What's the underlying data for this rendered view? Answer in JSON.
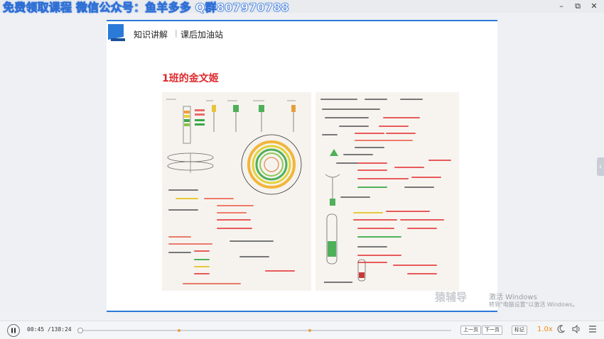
{
  "titlebar": {
    "watermark": "免费领取课程 微信公众号：鱼羊多多 Q群807970788",
    "minimize": "–",
    "maximize": "⧉",
    "close": "✕"
  },
  "slide": {
    "nav_primary": "知识讲解",
    "nav_separator": "|",
    "nav_secondary": "课后加油站",
    "heading": "1班的金文姬"
  },
  "overlay": {
    "brand": "猿辅导",
    "activate_title": "激活 Windows",
    "activate_hint": "转到\"电脑设置\"以激活 Windows。"
  },
  "player": {
    "time": "00:45 /138:24",
    "progress_fraction": 0.006,
    "chapter_marks": [
      0.27,
      0.62
    ],
    "prev_label": "上一页",
    "next_label": "下一页",
    "mark_label": "标记",
    "speed": "1.0x"
  },
  "side_handle": "‹",
  "colors": {
    "accent_blue": "#2a7ad8",
    "heading_red": "#e0282b",
    "progress_orange": "#f19a3e",
    "speed_orange": "#f08c1a"
  }
}
